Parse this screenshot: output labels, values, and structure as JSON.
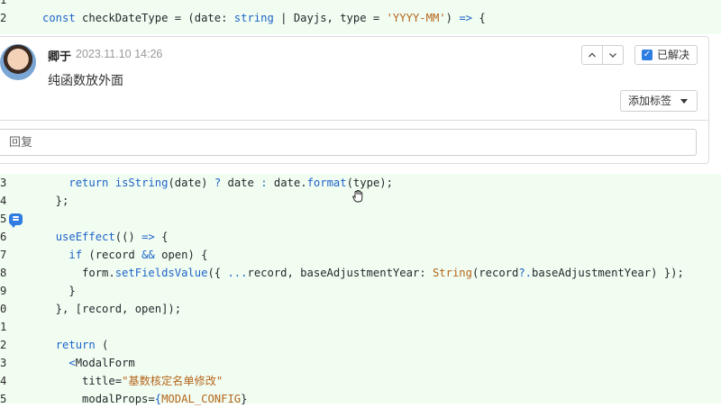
{
  "code_top": [
    {
      "ln": "1",
      "tokens": []
    },
    {
      "ln": "2",
      "tokens": [
        {
          "t": "kw",
          "v": "const"
        },
        {
          "t": "p",
          "v": " checkDateType = (date: "
        },
        {
          "t": "ty",
          "v": "string"
        },
        {
          "t": "p",
          "v": " | Dayjs, type = "
        },
        {
          "t": "str",
          "v": "'YYYY-MM'"
        },
        {
          "t": "p",
          "v": ") "
        },
        {
          "t": "op",
          "v": "=>"
        },
        {
          "t": "p",
          "v": " {"
        }
      ]
    }
  ],
  "comment": {
    "author": "卿于",
    "timestamp": "2023.11.10 14:26",
    "text": "纯函数放外面",
    "prev_label": "^",
    "next_label": "v",
    "resolved_label": "已解决",
    "resolved_checked": true,
    "add_tag_label": "添加标签",
    "reply_placeholder": "回复"
  },
  "code_bottom": [
    {
      "ln": "3",
      "tokens": [
        {
          "t": "p",
          "v": "    "
        },
        {
          "t": "kw",
          "v": "return"
        },
        {
          "t": "p",
          "v": " "
        },
        {
          "t": "fn",
          "v": "isString"
        },
        {
          "t": "p",
          "v": "(date) "
        },
        {
          "t": "op",
          "v": "?"
        },
        {
          "t": "p",
          "v": " date "
        },
        {
          "t": "op",
          "v": ":"
        },
        {
          "t": "p",
          "v": " date."
        },
        {
          "t": "fn",
          "v": "format"
        },
        {
          "t": "p",
          "v": "(type);"
        }
      ]
    },
    {
      "ln": "4",
      "tokens": [
        {
          "t": "p",
          "v": "  };"
        }
      ]
    },
    {
      "ln": "5",
      "tokens": []
    },
    {
      "ln": "6",
      "tokens": [
        {
          "t": "p",
          "v": "  "
        },
        {
          "t": "fn",
          "v": "useEffect"
        },
        {
          "t": "p",
          "v": "(() "
        },
        {
          "t": "op",
          "v": "=>"
        },
        {
          "t": "p",
          "v": " {"
        }
      ]
    },
    {
      "ln": "7",
      "tokens": [
        {
          "t": "p",
          "v": "    "
        },
        {
          "t": "kw",
          "v": "if"
        },
        {
          "t": "p",
          "v": " (record "
        },
        {
          "t": "op",
          "v": "&&"
        },
        {
          "t": "p",
          "v": " open) {"
        }
      ]
    },
    {
      "ln": "8",
      "tokens": [
        {
          "t": "p",
          "v": "      form."
        },
        {
          "t": "fn",
          "v": "setFieldsValue"
        },
        {
          "t": "p",
          "v": "({ "
        },
        {
          "t": "op",
          "v": "..."
        },
        {
          "t": "p",
          "v": "record, baseAdjustmentYear: "
        },
        {
          "t": "cls",
          "v": "String"
        },
        {
          "t": "p",
          "v": "(record"
        },
        {
          "t": "op",
          "v": "?."
        },
        {
          "t": "p",
          "v": "baseAdjustmentYear) });"
        }
      ]
    },
    {
      "ln": "9",
      "tokens": [
        {
          "t": "p",
          "v": "    }"
        }
      ]
    },
    {
      "ln": "0",
      "tokens": [
        {
          "t": "p",
          "v": "  }, [record, open]);"
        }
      ]
    },
    {
      "ln": "1",
      "tokens": []
    },
    {
      "ln": "2",
      "tokens": [
        {
          "t": "p",
          "v": "  "
        },
        {
          "t": "kw",
          "v": "return"
        },
        {
          "t": "p",
          "v": " ("
        }
      ]
    },
    {
      "ln": "3",
      "tokens": [
        {
          "t": "p",
          "v": "    "
        },
        {
          "t": "op",
          "v": "<"
        },
        {
          "t": "p",
          "v": "ModalForm"
        }
      ]
    },
    {
      "ln": "4",
      "tokens": [
        {
          "t": "p",
          "v": "      title="
        },
        {
          "t": "str",
          "v": "\"基数核定名单修改\""
        }
      ]
    },
    {
      "ln": "5",
      "tokens": [
        {
          "t": "p",
          "v": "      modalProps="
        },
        {
          "t": "op",
          "v": "{"
        },
        {
          "t": "cls",
          "v": "MODAL_CONFIG"
        },
        {
          "t": "p",
          "v": "}"
        }
      ]
    }
  ],
  "colors": {
    "code_bg": "#f1fdf1",
    "keyword": "#1e63c9",
    "string": "#b5651d",
    "accent": "#2f7de1"
  },
  "icons": {
    "comment_marker": "comment-bubble-icon",
    "cursor": "grab-hand-icon",
    "caret": "caret-down-icon",
    "check": "checkbox-checked-icon"
  }
}
